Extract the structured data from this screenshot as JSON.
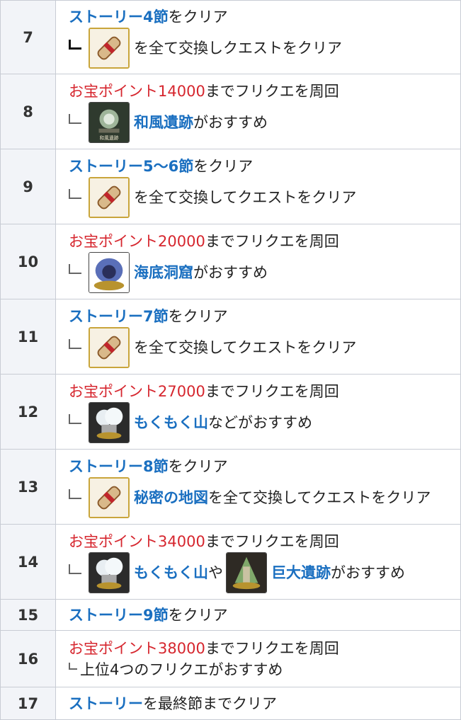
{
  "rows": [
    {
      "num": "7",
      "line1": {
        "link": "ストーリー4節",
        "suffix": "をクリア"
      },
      "line2": {
        "text": "を全て交換しクエストをクリア"
      }
    },
    {
      "num": "8",
      "line1": {
        "red": "お宝ポイント14000",
        "suffix": "までフリクエを周回"
      },
      "line2": {
        "link": "和風遺跡",
        "text": "がおすすめ",
        "icon_caption": "和風遺跡"
      }
    },
    {
      "num": "9",
      "line1": {
        "link": "ストーリー5〜6節",
        "suffix": "をクリア"
      },
      "line2": {
        "text": "を全て交換してクエストをクリア"
      }
    },
    {
      "num": "10",
      "line1": {
        "red": "お宝ポイント20000",
        "suffix": "までフリクエを周回"
      },
      "line2": {
        "link": "海底洞窟",
        "text": "がおすすめ"
      }
    },
    {
      "num": "11",
      "line1": {
        "link": "ストーリー7節",
        "suffix": "をクリア"
      },
      "line2": {
        "text": "を全て交換してクエストをクリア"
      }
    },
    {
      "num": "12",
      "line1": {
        "red": "お宝ポイント27000",
        "suffix": "までフリクエを周回"
      },
      "line2": {
        "link": "もくもく山",
        "text": "などがおすすめ"
      }
    },
    {
      "num": "13",
      "line1": {
        "link": "ストーリー8節",
        "suffix": "をクリア"
      },
      "line2": {
        "link": "秘密の地図",
        "text": "を全て交換してクエストをクリア"
      }
    },
    {
      "num": "14",
      "line1": {
        "red": "お宝ポイント34000",
        "suffix": "までフリクエを周回"
      },
      "line2": {
        "link": "もくもく山",
        "mid": "や",
        "link2": "巨大遺跡",
        "text": "がおすすめ"
      }
    },
    {
      "num": "15",
      "line1": {
        "link": "ストーリー9節",
        "suffix": "をクリア"
      }
    },
    {
      "num": "16",
      "line1": {
        "red": "お宝ポイント38000",
        "suffix": "までフリクエを周回"
      },
      "line2": {
        "text": "上位4つのフリクエがおすすめ"
      }
    },
    {
      "num": "17",
      "line1": {
        "link": "ストーリー",
        "suffix": "を最終節までクリア"
      }
    }
  ]
}
